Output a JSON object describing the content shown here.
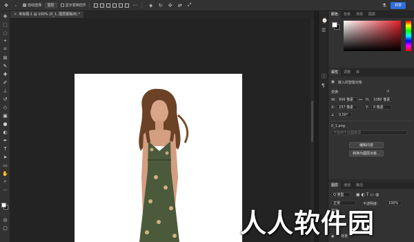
{
  "options_bar": {
    "auto_select_label": "自动选择:",
    "auto_select_value": "图层",
    "show_transform_label": "显示变换控件",
    "share_label": "共享"
  },
  "document_tab": {
    "title": "未标题-1 @ 100% (0_1, 图层蒙版/8) *",
    "close_symbol": "×"
  },
  "tools": [
    "move-icon",
    "marquee-icon",
    "lasso-icon",
    "object-select-icon",
    "crop-icon",
    "frame-icon",
    "eyedropper-icon",
    "healing-icon",
    "brush-icon",
    "stamp-icon",
    "history-brush-icon",
    "eraser-icon",
    "gradient-icon",
    "blur-icon",
    "dodge-icon",
    "pen-icon",
    "type-icon",
    "path-select-icon",
    "rectangle-icon",
    "hand-icon",
    "zoom-icon",
    "edit-toolbar-icon"
  ],
  "color_panel": {
    "tabs": [
      "颜色",
      "色板",
      "渐变",
      "图案"
    ],
    "foreground": "#ffffff",
    "background": "#000000"
  },
  "properties_panel": {
    "tabs": [
      "属性",
      "调整",
      "库"
    ],
    "object_type": "嵌入的智能对象",
    "section": "变换",
    "w_label": "W:",
    "w_value": "606 像素",
    "h_label": "H:",
    "h_value": "1080 像素",
    "x_label": "X:",
    "x_value": "237 像素",
    "y_label": "Y:",
    "y_value": "0 像素",
    "angle_value": "0.00°",
    "filename": "0_1.png",
    "unavailable": "不能用于此图像源",
    "edit_content": "编辑内容",
    "convert_layers": "转换为图层对象..."
  },
  "layers_panel": {
    "tabs": [
      "图层",
      "通道",
      "路径"
    ],
    "kind_label": "Q 类型",
    "blend_mode": "正常",
    "opacity_label": "不透明度:",
    "opacity_value": "100%",
    "lock_label": "锁定",
    "background_label": "背景"
  },
  "watermark": "人人软件园",
  "colors": {
    "accent": "#2f6fde",
    "dress": "#4a5a3a",
    "hair": "#6b4226"
  }
}
